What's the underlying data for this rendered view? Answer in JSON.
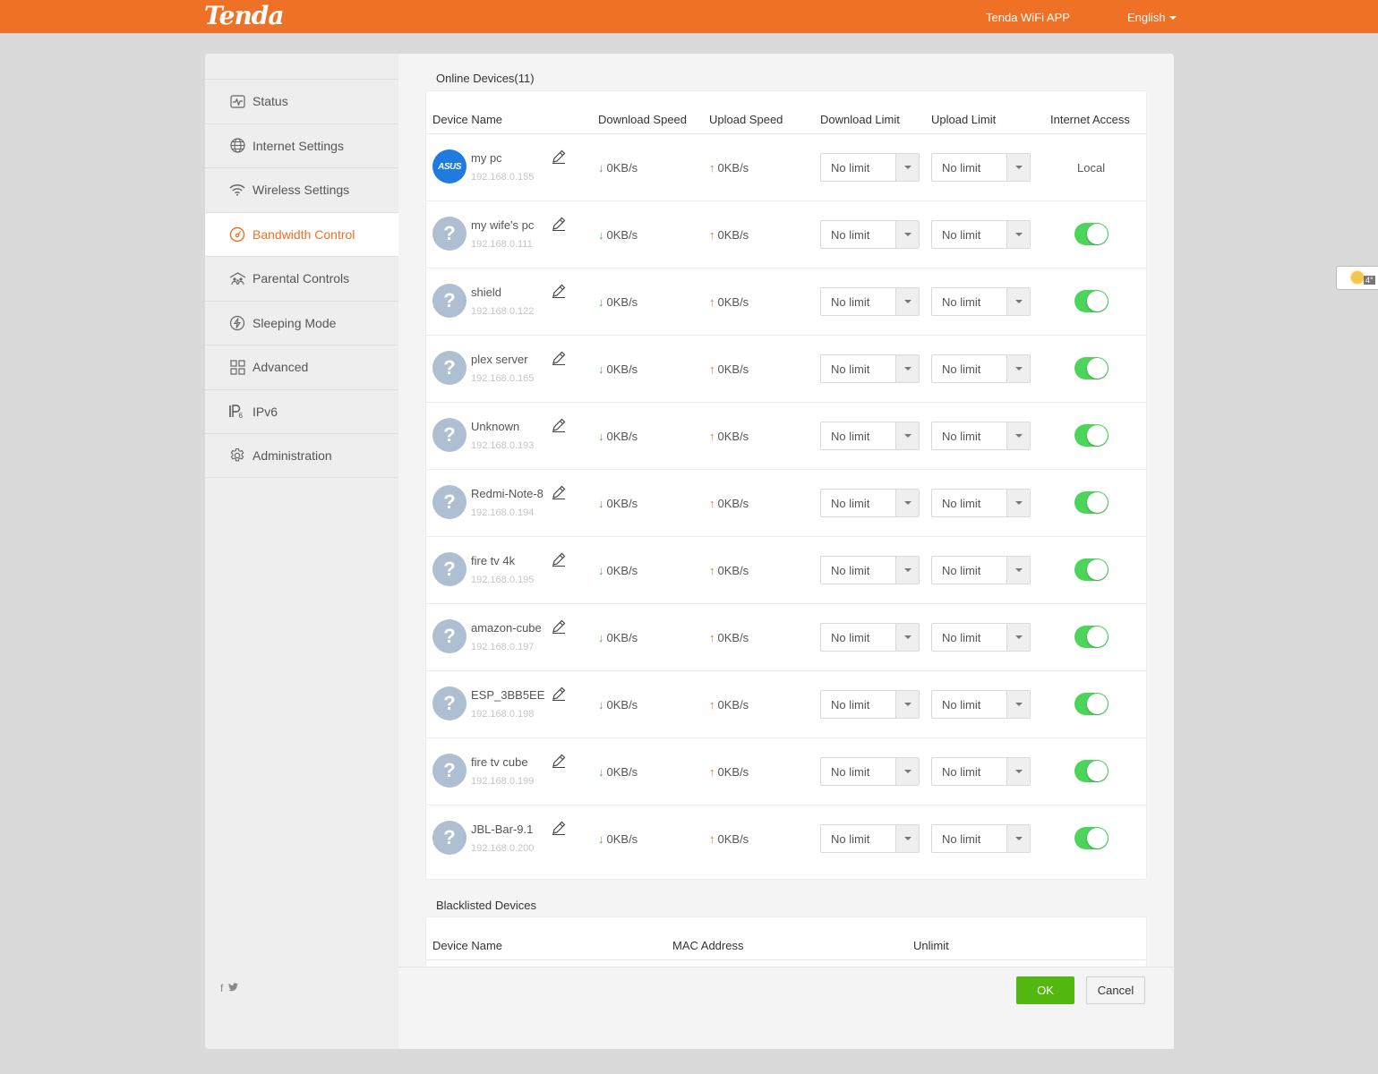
{
  "header": {
    "logo": "Tenda",
    "app_link": "Tenda WiFi APP",
    "language": "English"
  },
  "sidebar": {
    "items": [
      {
        "label": "Status",
        "icon": "pulse-icon",
        "active": false
      },
      {
        "label": "Internet Settings",
        "icon": "globe-icon",
        "active": false
      },
      {
        "label": "Wireless Settings",
        "icon": "wifi-icon",
        "active": false
      },
      {
        "label": "Bandwidth Control",
        "icon": "gauge-icon",
        "active": true
      },
      {
        "label": "Parental Controls",
        "icon": "family-icon",
        "active": false
      },
      {
        "label": "Sleeping Mode",
        "icon": "lightning-icon",
        "active": false
      },
      {
        "label": "Advanced",
        "icon": "grid-icon",
        "active": false
      },
      {
        "label": "IPv6",
        "icon": "ipv6-icon",
        "active": false
      },
      {
        "label": "Administration",
        "icon": "gear-icon",
        "active": false
      }
    ],
    "social": [
      "f",
      "twitter"
    ]
  },
  "online": {
    "title": "Online Devices(11)",
    "columns": {
      "name": "Device Name",
      "download_speed": "Download Speed",
      "upload_speed": "Upload Speed",
      "download_limit": "Download Limit",
      "upload_limit": "Upload Limit",
      "internet_access": "Internet Access"
    },
    "devices": [
      {
        "name": "my pc",
        "ip": "192.168.0.155",
        "down": "0KB/s",
        "up": "0KB/s",
        "dl_limit": "No limit",
        "ul_limit": "No limit",
        "access": "Local",
        "avatar": "ASUS"
      },
      {
        "name": "my wife's pc",
        "ip": "192.168.0.111",
        "down": "0KB/s",
        "up": "0KB/s",
        "dl_limit": "No limit",
        "ul_limit": "No limit",
        "access": "on",
        "avatar": "?"
      },
      {
        "name": "shield",
        "ip": "192.168.0.122",
        "down": "0KB/s",
        "up": "0KB/s",
        "dl_limit": "No limit",
        "ul_limit": "No limit",
        "access": "on",
        "avatar": "?"
      },
      {
        "name": "plex server",
        "ip": "192.168.0.165",
        "down": "0KB/s",
        "up": "0KB/s",
        "dl_limit": "No limit",
        "ul_limit": "No limit",
        "access": "on",
        "avatar": "?"
      },
      {
        "name": "Unknown",
        "ip": "192.168.0.193",
        "down": "0KB/s",
        "up": "0KB/s",
        "dl_limit": "No limit",
        "ul_limit": "No limit",
        "access": "on",
        "avatar": "?"
      },
      {
        "name": "Redmi-Note-8",
        "ip": "192.168.0.194",
        "down": "0KB/s",
        "up": "0KB/s",
        "dl_limit": "No limit",
        "ul_limit": "No limit",
        "access": "on",
        "avatar": "?"
      },
      {
        "name": "fire tv 4k",
        "ip": "192.168.0.195",
        "down": "0KB/s",
        "up": "0KB/s",
        "dl_limit": "No limit",
        "ul_limit": "No limit",
        "access": "on",
        "avatar": "?"
      },
      {
        "name": "amazon-cube",
        "ip": "192.168.0.197",
        "down": "0KB/s",
        "up": "0KB/s",
        "dl_limit": "No limit",
        "ul_limit": "No limit",
        "access": "on",
        "avatar": "?"
      },
      {
        "name": "ESP_3BB5EE",
        "ip": "192.168.0.198",
        "down": "0KB/s",
        "up": "0KB/s",
        "dl_limit": "No limit",
        "ul_limit": "No limit",
        "access": "on",
        "avatar": "?"
      },
      {
        "name": "fire tv cube",
        "ip": "192.168.0.199",
        "down": "0KB/s",
        "up": "0KB/s",
        "dl_limit": "No limit",
        "ul_limit": "No limit",
        "access": "on",
        "avatar": "?"
      },
      {
        "name": "JBL-Bar-9.1",
        "ip": "192.168.0.200",
        "down": "0KB/s",
        "up": "0KB/s",
        "dl_limit": "No limit",
        "ul_limit": "No limit",
        "access": "on",
        "avatar": "?"
      }
    ]
  },
  "blacklist": {
    "title": "Blacklisted Devices",
    "columns": {
      "name": "Device Name",
      "mac": "MAC Address",
      "unlimit": "Unlimit"
    }
  },
  "actions": {
    "ok": "OK",
    "cancel": "Cancel"
  },
  "widget": {
    "temp": "4°"
  },
  "colors": {
    "brand": "#ef7125",
    "toggle_on": "#4cd45b",
    "ok_button": "#52b80f",
    "down_arrow": "#4caf50",
    "up_arrow": "#ef7125"
  }
}
